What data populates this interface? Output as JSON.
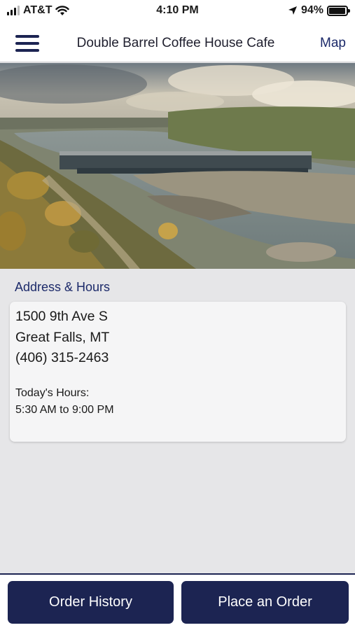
{
  "status_bar": {
    "carrier": "AT&T",
    "time": "4:10 PM",
    "battery_percent": "94%",
    "battery_level": 0.94,
    "icons": [
      "signal-icon",
      "wifi-icon",
      "location-arrow-icon",
      "battery-icon"
    ]
  },
  "nav": {
    "menu_icon": "hamburger-menu-icon",
    "title": "Double Barrel Coffee House Cafe",
    "map_label": "Map"
  },
  "hero": {
    "image_subject": "river-dam-landscape"
  },
  "address_section": {
    "title": "Address & Hours",
    "street": "1500 9th Ave S",
    "city_state": "Great Falls, MT",
    "phone": "(406) 315-2463",
    "hours_label": "Today's Hours:",
    "hours_value": "5:30 AM to 9:00 PM"
  },
  "actions": {
    "order_history_label": "Order History",
    "place_order_label": "Place an Order"
  },
  "colors": {
    "brand_navy": "#1c2452",
    "link_blue": "#1c2a6a",
    "page_background": "#e6e6e8"
  }
}
